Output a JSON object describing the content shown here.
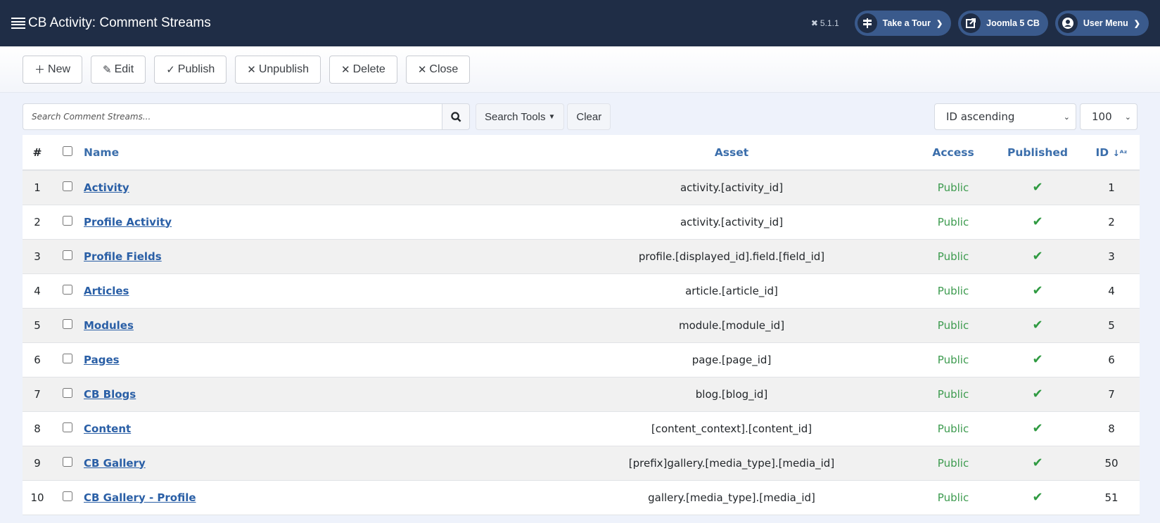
{
  "header": {
    "title": "CB Activity: Comment Streams",
    "title_icon": "list-icon",
    "version": "5.1.1",
    "version_icon": "joomla-icon",
    "buttons": [
      {
        "label": "Take a Tour",
        "icon": "signpost-icon",
        "dropdown": true
      },
      {
        "label": "Joomla 5 CB",
        "icon": "external-link-icon",
        "dropdown": false
      },
      {
        "label": "User Menu",
        "icon": "user-circle-icon",
        "dropdown": true
      }
    ]
  },
  "toolbar": {
    "new_label": "New",
    "edit_label": "Edit",
    "publish_label": "Publish",
    "unpublish_label": "Unpublish",
    "delete_label": "Delete",
    "close_label": "Close"
  },
  "filters": {
    "search_placeholder": "Search Comment Streams...",
    "search_value": "",
    "search_tools_label": "Search Tools",
    "clear_label": "Clear",
    "sort_selected": "ID ascending",
    "limit_selected": "100"
  },
  "table": {
    "columns": {
      "num": "#",
      "name": "Name",
      "asset": "Asset",
      "access": "Access",
      "published": "Published",
      "id": "ID"
    },
    "rows": [
      {
        "num": "1",
        "name": "Activity",
        "asset": "activity.[activity_id]",
        "access": "Public",
        "published": true,
        "id": "1"
      },
      {
        "num": "2",
        "name": "Profile Activity",
        "asset": "activity.[activity_id]",
        "access": "Public",
        "published": true,
        "id": "2"
      },
      {
        "num": "3",
        "name": "Profile Fields",
        "asset": "profile.[displayed_id].field.[field_id]",
        "access": "Public",
        "published": true,
        "id": "3"
      },
      {
        "num": "4",
        "name": "Articles",
        "asset": "article.[article_id]",
        "access": "Public",
        "published": true,
        "id": "4"
      },
      {
        "num": "5",
        "name": "Modules",
        "asset": "module.[module_id]",
        "access": "Public",
        "published": true,
        "id": "5"
      },
      {
        "num": "6",
        "name": "Pages",
        "asset": "page.[page_id]",
        "access": "Public",
        "published": true,
        "id": "6"
      },
      {
        "num": "7",
        "name": "CB Blogs",
        "asset": "blog.[blog_id]",
        "access": "Public",
        "published": true,
        "id": "7"
      },
      {
        "num": "8",
        "name": "Content",
        "asset": "[content_context].[content_id]",
        "access": "Public",
        "published": true,
        "id": "8"
      },
      {
        "num": "9",
        "name": "CB Gallery",
        "asset": "[prefix]gallery.[media_type].[media_id]",
        "access": "Public",
        "published": true,
        "id": "50"
      },
      {
        "num": "10",
        "name": "CB Gallery - Profile",
        "asset": "gallery.[media_type].[media_id]",
        "access": "Public",
        "published": true,
        "id": "51"
      }
    ]
  },
  "colors": {
    "header_bg": "#1f2d46",
    "pill_bg": "#3a5a8c",
    "link": "#2a5fa6",
    "access_green": "#3d9b4f",
    "check_green": "#2f9a41"
  }
}
